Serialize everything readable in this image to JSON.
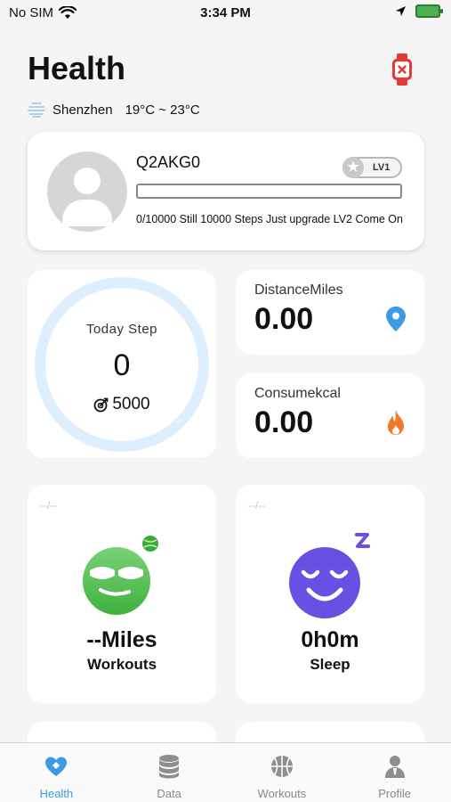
{
  "status_bar": {
    "carrier": "No SIM",
    "time": "3:34 PM"
  },
  "header": {
    "title": "Health"
  },
  "weather": {
    "city": "Shenzhen",
    "temperature_range": "19°C ~ 23°C"
  },
  "profile": {
    "username": "Q2AKG0",
    "level": "LV1",
    "progress_fraction": 0.0,
    "upgrade_message": "0/10000 Still 10000 Steps Just upgrade LV2 Come On"
  },
  "steps": {
    "label": "Today   Step",
    "value": "0",
    "goal": "5000"
  },
  "metrics": {
    "distance": {
      "label": "DistanceMiles",
      "value": "0.00",
      "icon": "location-pin-icon"
    },
    "calories": {
      "label": "Consumekcal",
      "value": "0.00",
      "icon": "flame-icon"
    }
  },
  "tiles": {
    "workouts": {
      "date": "--/--",
      "value": "--Miles",
      "name": "Workouts"
    },
    "sleep": {
      "date": "--/--",
      "value": "0h0m",
      "name": "Sleep"
    }
  },
  "tab_bar": {
    "items": [
      {
        "label": "Health",
        "icon": "heart-icon",
        "active": true
      },
      {
        "label": "Data",
        "icon": "database-icon",
        "active": false
      },
      {
        "label": "Workouts",
        "icon": "basketball-icon",
        "active": false
      },
      {
        "label": "Profile",
        "icon": "person-icon",
        "active": false
      }
    ]
  },
  "colors": {
    "accent": "#3c9be3",
    "workouts_face": "#4cc24a",
    "sleep_face": "#6a4fe3",
    "watch_disconnected": "#e53935"
  }
}
